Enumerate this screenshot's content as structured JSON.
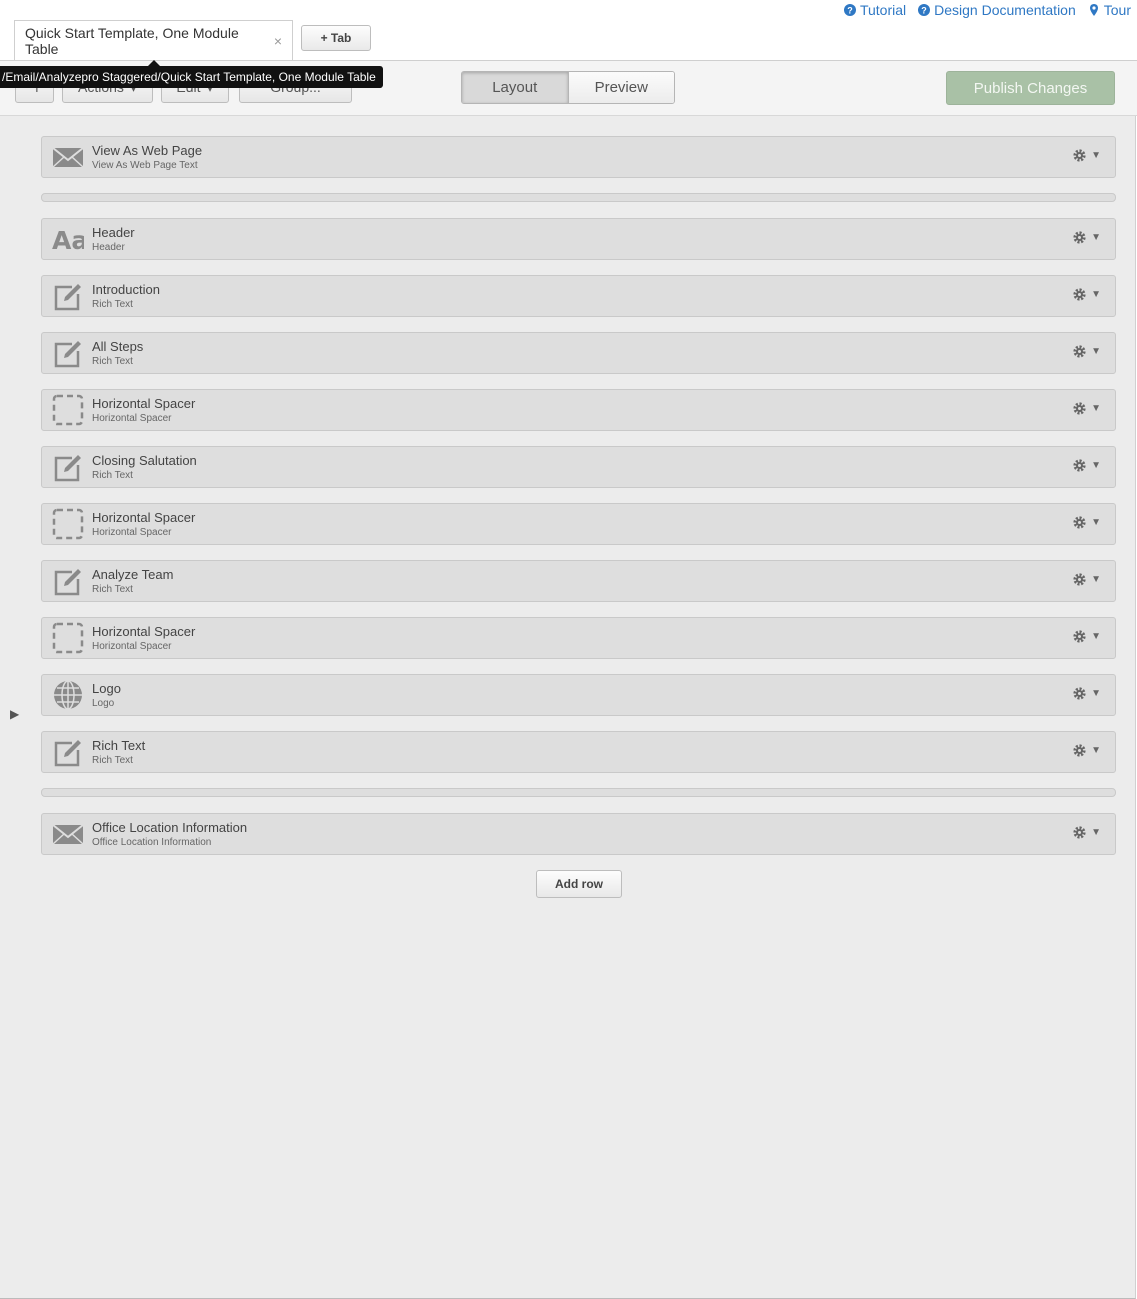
{
  "top_links": [
    {
      "label": "Tutorial",
      "icon": "help-circle-icon"
    },
    {
      "label": "Design Documentation",
      "icon": "help-circle-icon"
    },
    {
      "label": "Tour",
      "icon": "map-pin-icon"
    }
  ],
  "tabs": {
    "active_label": "Quick Start Template, One Module Table",
    "close_glyph": "×",
    "add_label": "+ Tab"
  },
  "tooltip": "/Email/Analyzepro Staggered/Quick Start Template, One Module Table",
  "toolbar": {
    "back_glyph": "↰",
    "actions_label": "Actions",
    "edit_label": "Edit",
    "group_label": "Group...",
    "layout_label": "Layout",
    "preview_label": "Preview",
    "publish_label": "Publish Changes"
  },
  "colors": {
    "link": "#2f78c4",
    "publish_bg": "#a9c1a6",
    "row_bg": "#dedede",
    "canvas_bg": "#ececec"
  },
  "modules": [
    {
      "title": "View As Web Page",
      "subtitle": "View As Web Page Text",
      "icon": "envelope-icon"
    },
    {
      "title": "Header",
      "subtitle": "Header",
      "icon": "text-aa-icon"
    },
    {
      "title": "Introduction",
      "subtitle": "Rich Text",
      "icon": "edit-icon"
    },
    {
      "title": "All Steps",
      "subtitle": "Rich Text",
      "icon": "edit-icon"
    },
    {
      "title": "Horizontal Spacer",
      "subtitle": "Horizontal Spacer",
      "icon": "dashed-square-icon"
    },
    {
      "title": "Closing Salutation",
      "subtitle": "Rich Text",
      "icon": "edit-icon"
    },
    {
      "title": "Horizontal Spacer",
      "subtitle": "Horizontal Spacer",
      "icon": "dashed-square-icon"
    },
    {
      "title": "Analyze Team",
      "subtitle": "Rich Text",
      "icon": "edit-icon"
    },
    {
      "title": "Horizontal Spacer",
      "subtitle": "Horizontal Spacer",
      "icon": "dashed-square-icon"
    },
    {
      "title": "Logo",
      "subtitle": "Logo",
      "icon": "globe-icon"
    },
    {
      "title": "Rich Text",
      "subtitle": "Rich Text",
      "icon": "edit-icon"
    },
    {
      "title": "Office Location Information",
      "subtitle": "Office Location Information",
      "icon": "envelope-icon"
    }
  ],
  "add_row_label": "Add row"
}
